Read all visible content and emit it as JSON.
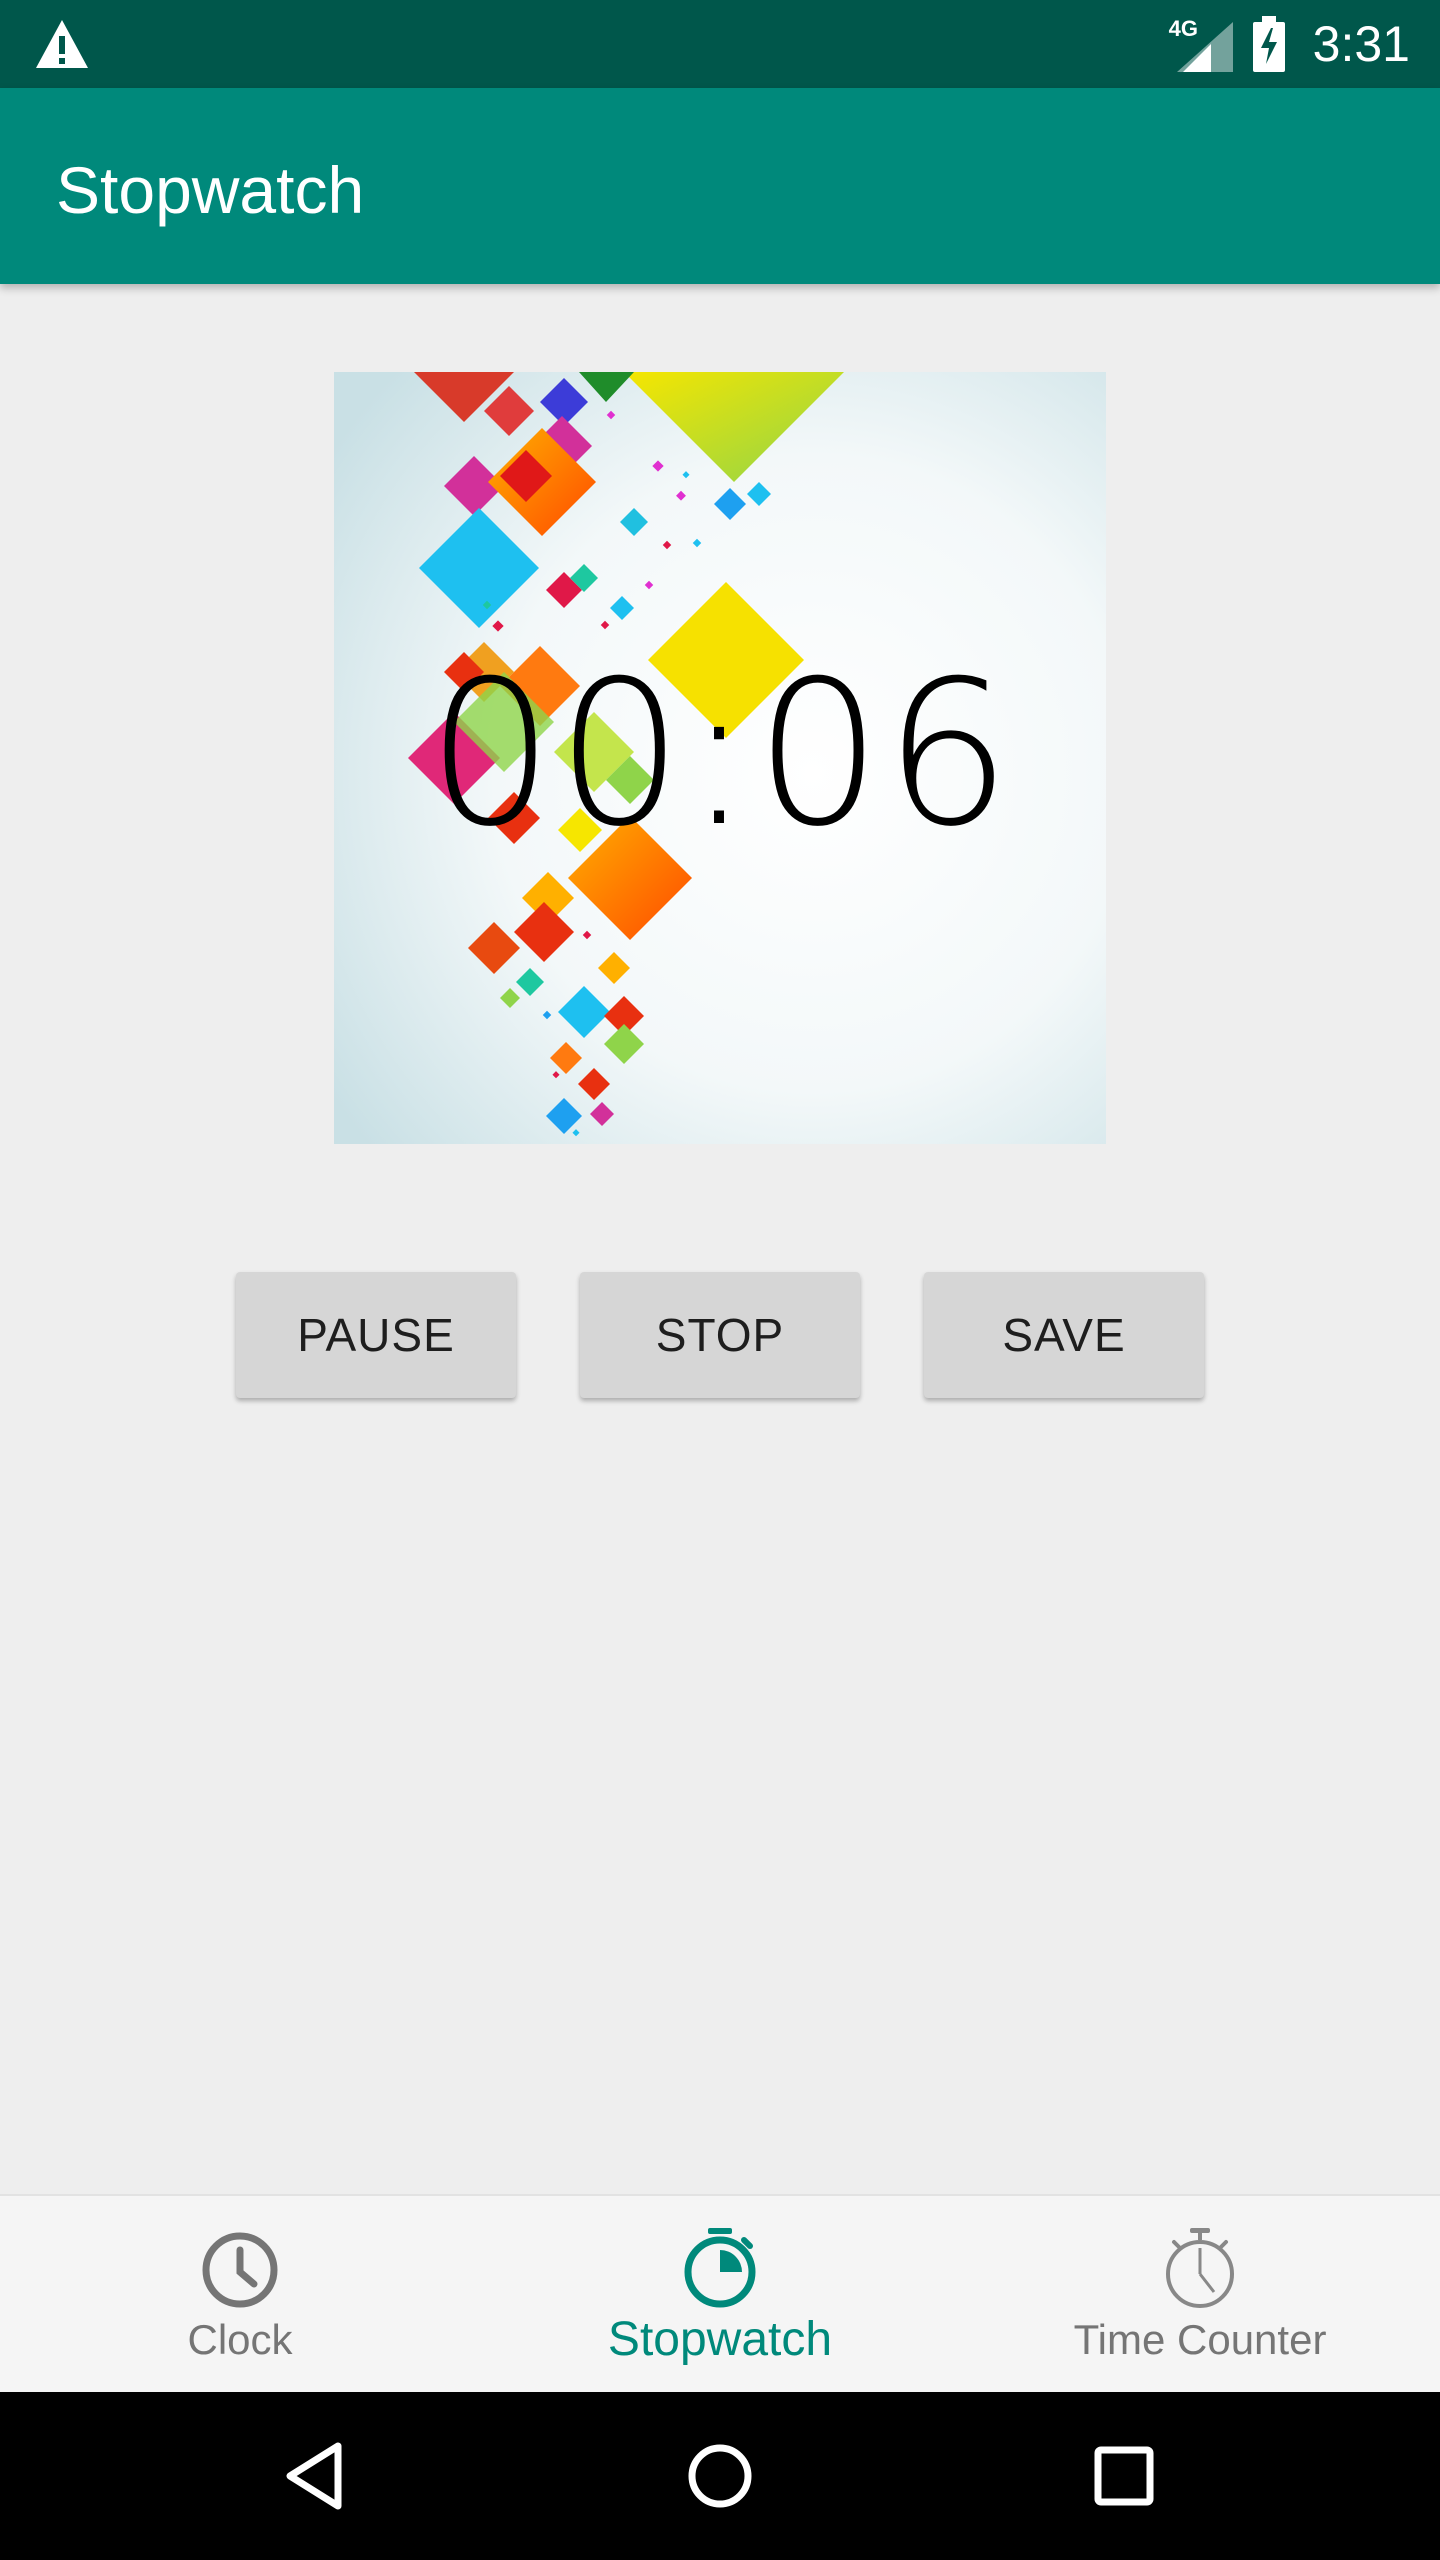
{
  "status_bar": {
    "time": "3:31",
    "network_type": "4G",
    "icons": [
      "warning-icon",
      "signal-icon",
      "battery-charging-icon"
    ],
    "background_color": "#00574b"
  },
  "app_bar": {
    "title": "Stopwatch",
    "background_color": "#00897b"
  },
  "stopwatch": {
    "elapsed_time": "00:06",
    "background_image": "colorful-diamonds-artwork"
  },
  "controls": {
    "pause_label": "PAUSE",
    "stop_label": "STOP",
    "save_label": "SAVE"
  },
  "bottom_nav": {
    "items": [
      {
        "label": "Clock",
        "icon": "clock-icon",
        "selected": false
      },
      {
        "label": "Stopwatch",
        "icon": "stopwatch-icon",
        "selected": true
      },
      {
        "label": "Time Counter",
        "icon": "timer-icon",
        "selected": false
      }
    ],
    "active_color": "#00897b",
    "inactive_color": "#757575"
  },
  "system_nav": {
    "buttons": [
      "back-icon",
      "home-icon",
      "recents-icon"
    ]
  }
}
